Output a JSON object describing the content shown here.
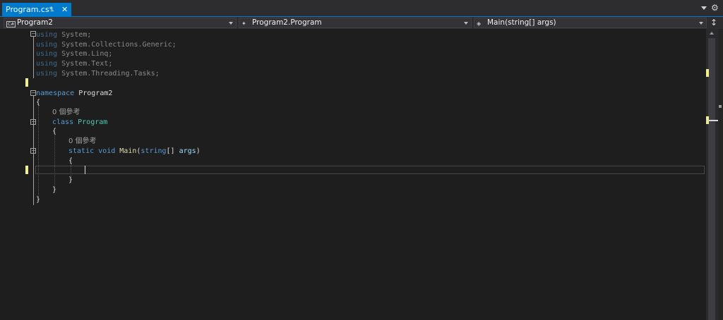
{
  "tab": {
    "title": "Program.cs*",
    "pin_icon": "pin-icon",
    "close_icon": "close-icon"
  },
  "navbar": {
    "project": "Program2",
    "type": "Program2.Program",
    "member": "Main(string[] args)"
  },
  "code": {
    "using_kw": "using",
    "usings": [
      "System;",
      "System.Collections.Generic;",
      "System.Linq;",
      "System.Text;",
      "System.Threading.Tasks;"
    ],
    "namespace_kw": "namespace",
    "namespace_name": "Program2",
    "open_brace": "{",
    "close_brace": "}",
    "class_lens": "0 個參考",
    "class_kw": "class",
    "class_name": "Program",
    "method_lens": "0 個參考",
    "static_kw": "static",
    "void_kw": "void",
    "method_name": "Main",
    "paren_open": "(",
    "string_kw": "string",
    "array_brackets": "[] ",
    "param_name": "args",
    "paren_close": ")"
  },
  "colors": {
    "accent": "#007acc",
    "background": "#1e1e1e",
    "keyword": "#569cd6",
    "type": "#4ec9b0",
    "method": "#dcdcaa",
    "change_marker": "#efef91"
  }
}
